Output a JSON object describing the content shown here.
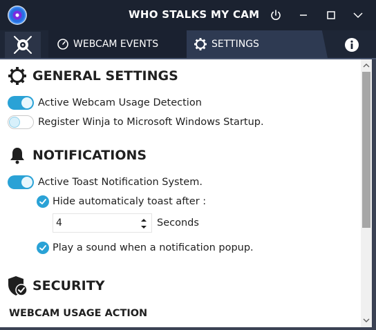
{
  "window": {
    "title": "WHO STALKS MY CAM",
    "logo_icon": "webcam-logo-icon",
    "controls": [
      "power-icon",
      "minimize-icon",
      "maximize-icon",
      "chevron-down-icon"
    ]
  },
  "tabs": [
    {
      "label": "WEBCAM EVENTS",
      "icon": "timer-icon",
      "active": false
    },
    {
      "label": "SETTINGS",
      "icon": "gear-icon",
      "active": true
    }
  ],
  "tab_logo_icon": "bug-webcam-icon",
  "info_icon": "info-icon",
  "general": {
    "title": "GENERAL SETTINGS",
    "icon": "gear-icon",
    "options": [
      {
        "label": "Active Webcam Usage Detection",
        "enabled": true
      },
      {
        "label": "Register Winja to Microsoft Windows Startup.",
        "enabled": false
      }
    ]
  },
  "notifications": {
    "title": "NOTIFICATIONS",
    "icon": "bell-icon",
    "toast_label": "Active Toast Notification System.",
    "toast_enabled": true,
    "hide_label": "Hide automaticaly toast after :",
    "hide_checked": true,
    "hide_value": "4",
    "hide_unit": "Seconds",
    "sound_label": "Play a sound when a notification popup.",
    "sound_checked": true
  },
  "security": {
    "title": "SECURITY",
    "icon": "shield-check-icon",
    "subheading": "WEBCAM USAGE ACTION"
  },
  "colors": {
    "titlebar": "#1b2230",
    "accent": "#2aa2d6",
    "active_tab": "#2e3a52"
  }
}
